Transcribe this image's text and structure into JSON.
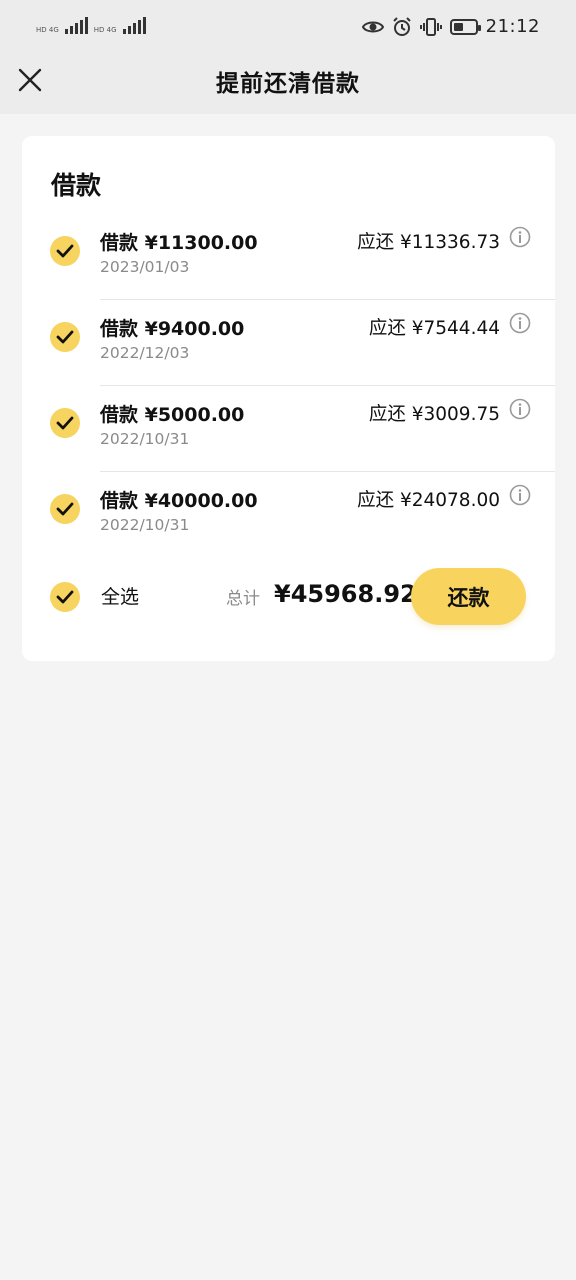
{
  "status_bar": {
    "net1": "HD 4G",
    "net2": "HD 4G",
    "time": "21:12",
    "icons": [
      "eye-icon",
      "alarm-icon",
      "vibrate-icon",
      "battery-icon"
    ]
  },
  "nav": {
    "title": "提前还清借款",
    "close_icon": "close-icon"
  },
  "card": {
    "title": "借款",
    "loans": [
      {
        "amount": "借款 ¥11300.00",
        "date": "2023/01/03",
        "due": "应还 ¥11336.73",
        "checked": true
      },
      {
        "amount": "借款 ¥9400.00",
        "date": "2022/12/03",
        "due": "应还 ¥7544.44",
        "checked": true
      },
      {
        "amount": "借款 ¥5000.00",
        "date": "2022/10/31",
        "due": "应还 ¥3009.75",
        "checked": true
      },
      {
        "amount": "借款 ¥40000.00",
        "date": "2022/10/31",
        "due": "应还 ¥24078.00",
        "checked": true
      }
    ],
    "select_all_label": "全选",
    "total_label": "总计",
    "total_value": "¥45968.92",
    "repay_label": "还款"
  },
  "colors": {
    "accent": "#f7d35f",
    "background": "#f4f4f4",
    "header_bg": "#ececec"
  }
}
